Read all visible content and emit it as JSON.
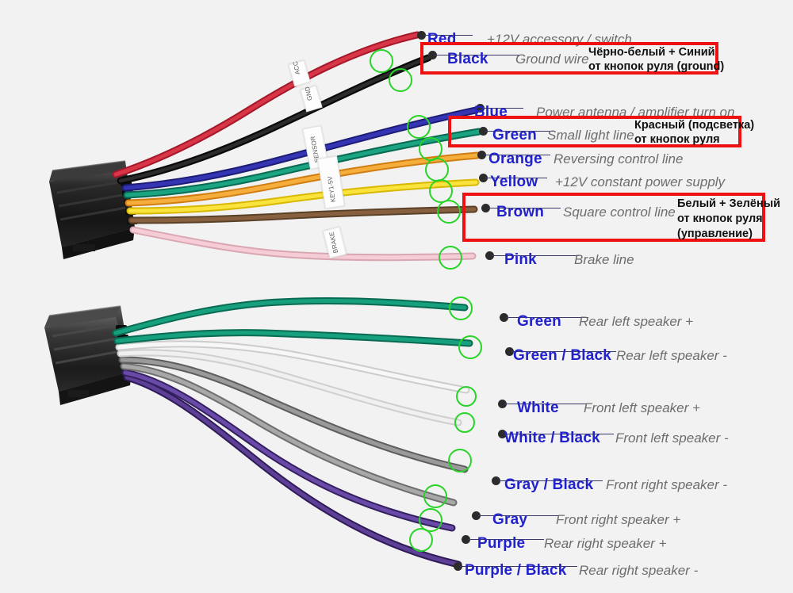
{
  "background_color": "#f2f2f2",
  "colors": {
    "label_name": "#2222cc",
    "label_desc": "#6d6d6d",
    "annotation_border": "#ee1111",
    "marker_circle": "#28d428",
    "connector_dot": "#2b2b2b"
  },
  "top_harness": {
    "connector_name": "power-connector",
    "rows": [
      {
        "color_label": "Red",
        "description": "+12V accessory / switch",
        "wire_color": "#d2293a"
      },
      {
        "color_label": "Black",
        "description": "Ground wire",
        "wire_color": "#1a1a1a"
      },
      {
        "color_label": "Blue",
        "description": "Power antenna / amplifier turn on",
        "wire_color": "#2a2a9e"
      },
      {
        "color_label": "Green",
        "description": "Small light line",
        "wire_color": "#12876b"
      },
      {
        "color_label": "Orange",
        "description": "Reversing control line",
        "wire_color": "#ed9a24"
      },
      {
        "color_label": "Yellow",
        "description": "+12V constant power supply",
        "wire_color": "#f2da1f"
      },
      {
        "color_label": "Brown",
        "description": "Square control line",
        "wire_color": "#7a5a3c"
      },
      {
        "color_label": "Pink",
        "description": "Brake line",
        "wire_color": "#f0bcc6"
      }
    ]
  },
  "bottom_harness": {
    "connector_name": "speaker-connector",
    "rows": [
      {
        "color_label": "Green",
        "description": "Rear left speaker +",
        "wire_color": "#12876b"
      },
      {
        "color_label": "Green / Black",
        "description": "Rear left speaker -",
        "wire_color": "#12876b"
      },
      {
        "color_label": "White",
        "description": "Front left speaker +",
        "wire_color": "#f4f4f4"
      },
      {
        "color_label": "White / Black",
        "description": "Front left speaker -",
        "wire_color": "#ededed"
      },
      {
        "color_label": "Gray / Black",
        "description": "Front right speaker -",
        "wire_color": "#8c8c8c"
      },
      {
        "color_label": "Gray",
        "description": "Front right speaker +",
        "wire_color": "#a6a6a6"
      },
      {
        "color_label": "Purple",
        "description": "Rear right speaker +",
        "wire_color": "#5c3b97"
      },
      {
        "color_label": "Purple / Black",
        "description": "Rear right speaker -",
        "wire_color": "#4a2f80"
      }
    ]
  },
  "annotations": [
    {
      "id": "black-ground",
      "target_row": "Black",
      "lines": [
        "Чёрно-белый + Синий",
        "от кнопок руля (ground)"
      ]
    },
    {
      "id": "green-illumination",
      "target_row": "Green",
      "lines": [
        "Красный (подсветка)",
        "от кнопок руля"
      ]
    },
    {
      "id": "brown-steering-control",
      "target_row": "Brown",
      "lines": [
        "Белый + Зелёный",
        "от кнопок руля",
        "(управление)"
      ]
    }
  ],
  "wire_tags": [
    {
      "text": "ACC"
    },
    {
      "text": "GND"
    },
    {
      "text": "SENSOR"
    },
    {
      "text": "KEY1-5V"
    },
    {
      "text": "BRAKE"
    }
  ]
}
